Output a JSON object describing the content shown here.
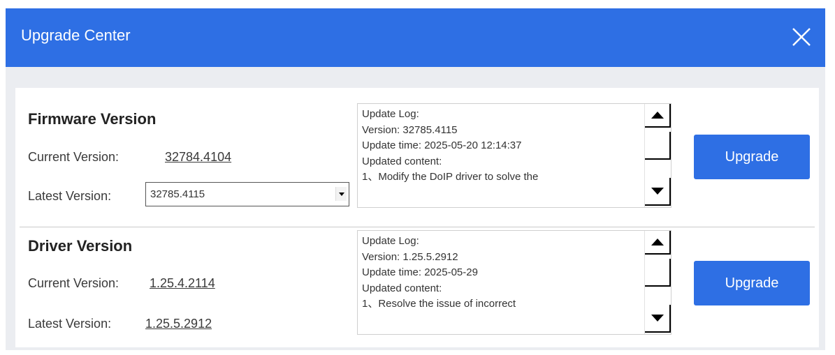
{
  "window": {
    "title": "Upgrade Center",
    "close_icon": "close-icon"
  },
  "firmware": {
    "title": "Firmware Version",
    "current_label": "Current Version:",
    "current_value": "32784.4104",
    "latest_label": "Latest Version:",
    "latest_selected": "32785.4115",
    "log": [
      "Update Log:",
      "Version:   32785.4115",
      "Update time:    2025-05-20 12:14:37",
      "Updated content:",
      "1、Modify the DoIP driver to solve the"
    ],
    "upgrade_label": "Upgrade"
  },
  "driver": {
    "title": "Driver Version",
    "current_label": "Current Version:",
    "current_value": "1.25.4.2114",
    "latest_label": "Latest Version:",
    "latest_value": "1.25.5.2912",
    "log": [
      "Update Log:",
      "Version:   1.25.5.2912",
      "Update time:   2025-05-29",
      "Updated content:",
      "1、Resolve the issue of incorrect"
    ],
    "upgrade_label": "Upgrade"
  },
  "colors": {
    "accent": "#2e6fe4",
    "background": "#ebedf1",
    "panel": "#ffffff"
  }
}
